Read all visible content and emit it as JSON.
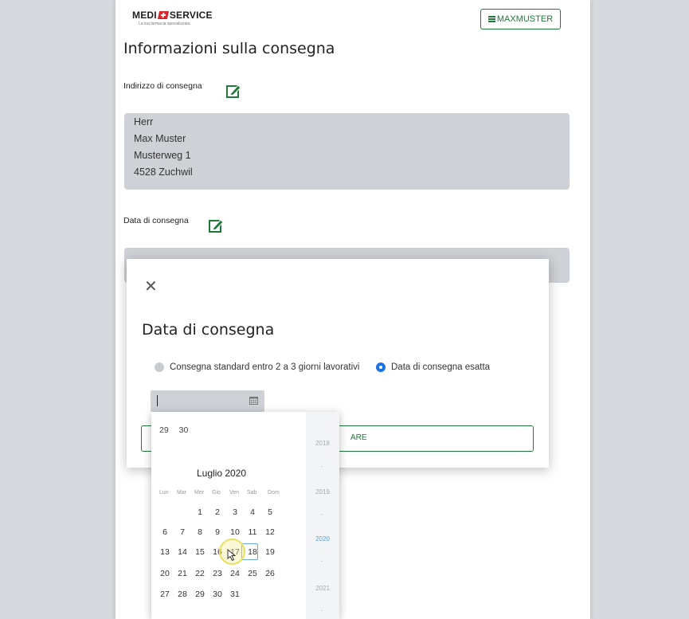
{
  "brand": {
    "name_part1": "MEDI",
    "name_part2": "SERVICE",
    "tagline": "La tua farmacia specializzata"
  },
  "header": {
    "user_label": "MAXMUSTER"
  },
  "page_title": "Informazioni sulla consegna",
  "address": {
    "label": "Indirizzo di consegna",
    "lines": [
      "Herr",
      "Max Muster",
      "Musterweg 1",
      "4528 Zuchwil"
    ]
  },
  "delivery_date": {
    "label": "Data di consegna"
  },
  "modal": {
    "close_symbol": "✕",
    "title": "Data di consegna",
    "option_standard": "Consegna standard entro 2 a 3 giorni lavorativi",
    "option_exact": "Data di consegna esatta",
    "confirm_label_partial": "ARE"
  },
  "calendar": {
    "prev_days": [
      "29",
      "30"
    ],
    "month_title": "Luglio 2020",
    "weekdays": [
      "Lun",
      "Mar",
      "Mer",
      "Gio",
      "Ven",
      "Sab",
      "Dom"
    ],
    "weeks": [
      [
        "",
        "",
        "1",
        "2",
        "3",
        "4",
        "5"
      ],
      [
        "6",
        "7",
        "8",
        "9",
        "10",
        "11",
        "12"
      ],
      [
        "13",
        "14",
        "15",
        "16",
        "17",
        "18",
        "19"
      ],
      [
        "20",
        "21",
        "22",
        "23",
        "24",
        "25",
        "26"
      ],
      [
        "27",
        "28",
        "29",
        "30",
        "31",
        "",
        ""
      ]
    ],
    "today": "17",
    "hovered": "16",
    "years": [
      "2018",
      "2019",
      "2020",
      "2021"
    ],
    "current_year": "2020"
  },
  "colors": {
    "brand_green": "#1f7a3a",
    "brand_red": "#d7262e",
    "accent_blue": "#1a73e8"
  }
}
